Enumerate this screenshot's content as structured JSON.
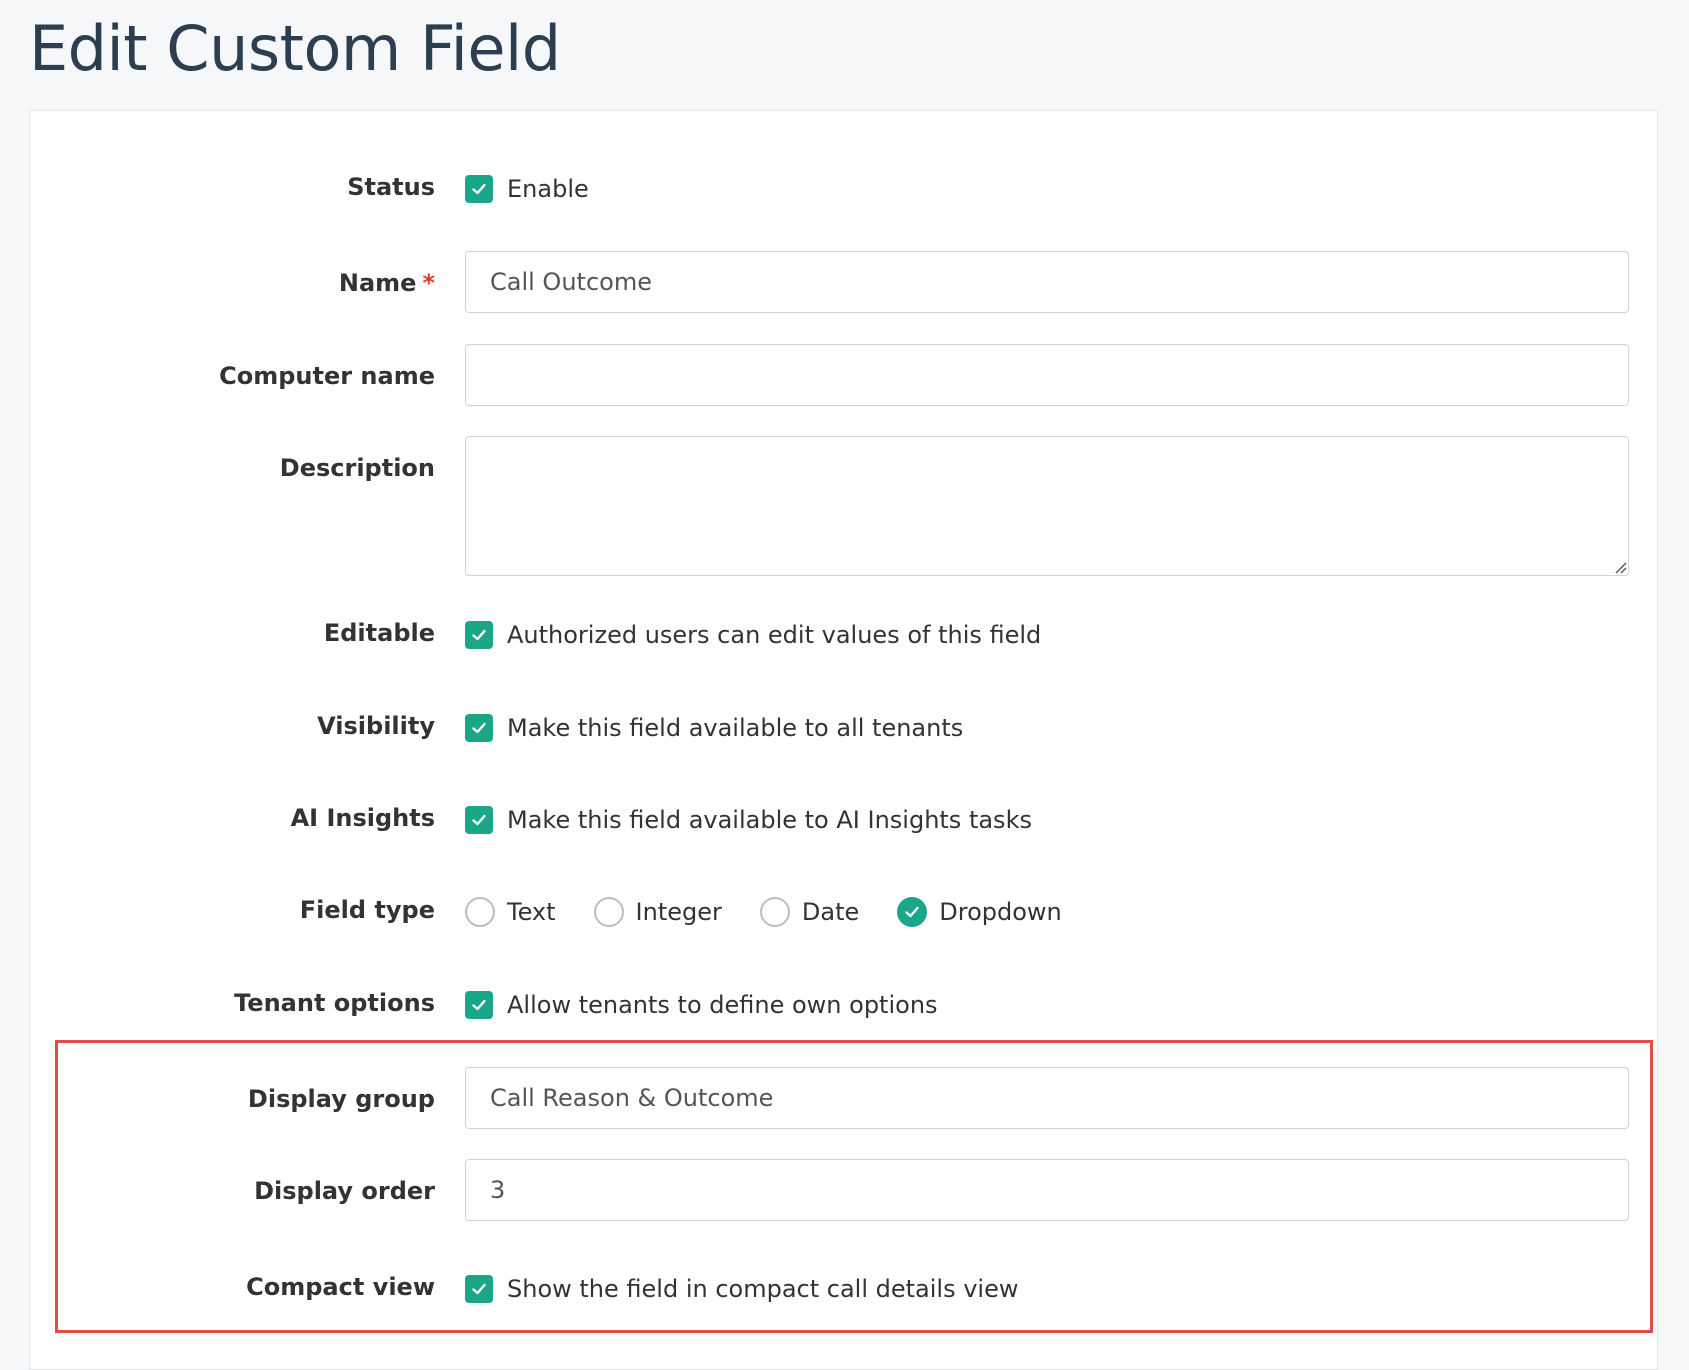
{
  "page": {
    "title": "Edit Custom Field"
  },
  "form": {
    "status": {
      "label": "Status",
      "checkbox_label": "Enable",
      "checked": true
    },
    "name": {
      "label": "Name",
      "required_mark": "*",
      "value": "Call Outcome"
    },
    "computer_name": {
      "label": "Computer name",
      "value": ""
    },
    "description": {
      "label": "Description",
      "value": ""
    },
    "editable": {
      "label": "Editable",
      "checkbox_label": "Authorized users can edit values of this field",
      "checked": true
    },
    "visibility": {
      "label": "Visibility",
      "checkbox_label": "Make this field available to all tenants",
      "checked": true
    },
    "ai_insights": {
      "label": "AI Insights",
      "checkbox_label": "Make this field available to AI Insights tasks",
      "checked": true
    },
    "field_type": {
      "label": "Field type",
      "options": [
        "Text",
        "Integer",
        "Date",
        "Dropdown"
      ],
      "selected": "Dropdown"
    },
    "tenant_options": {
      "label": "Tenant options",
      "checkbox_label": "Allow tenants to define own options",
      "checked": true
    },
    "display_group": {
      "label": "Display group",
      "value": "Call Reason & Outcome"
    },
    "display_order": {
      "label": "Display order",
      "value": "3"
    },
    "compact_view": {
      "label": "Compact view",
      "checkbox_label": "Show the field in compact call details view",
      "checked": true
    }
  },
  "colors": {
    "accent": "#1ba689",
    "highlight": "#e34a4a",
    "required": "#e03c31",
    "title": "#2c3e50"
  },
  "icons": {
    "checkbox_checked": "check-icon",
    "radio_checked": "check-icon",
    "textarea_resize": "resize-grip-icon"
  }
}
